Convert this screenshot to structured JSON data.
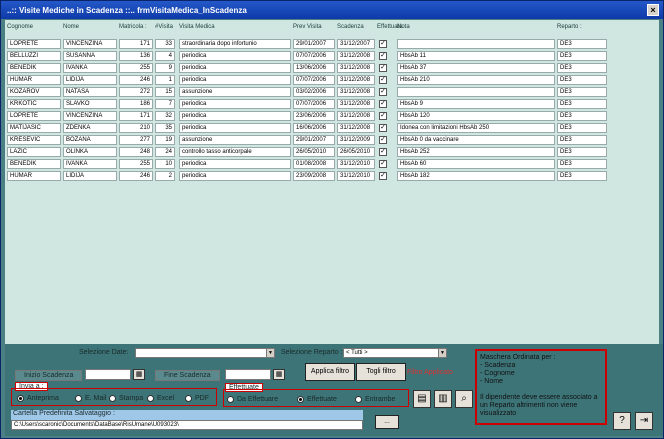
{
  "title": "..:: Visite Mediche in Scadenza ::..   frmVisitaMedica_InScadenza",
  "columns": [
    "Cognome",
    "Nome",
    "Matricola :",
    "#Visita",
    "Visita Medica",
    "Prev Visita",
    "Scadenza",
    "Effettuata",
    "Nota",
    "Reparto :"
  ],
  "rows": [
    [
      "LOPRETE",
      "VINCENZINA",
      "171",
      "33",
      "straordinaria dopo infortunio",
      "29/01/2007",
      "31/12/2007",
      "✓",
      "",
      "DE3"
    ],
    [
      "BELLUZZI",
      "SUSANNA",
      "136",
      "4",
      "periodica",
      "07/07/2006",
      "31/12/2008",
      "✓",
      "HbsAb 11",
      "DE3"
    ],
    [
      "BENEDIK",
      "IVANKA",
      "255",
      "9",
      "periodica",
      "13/06/2006",
      "31/12/2008",
      "✓",
      "HbsAb 37",
      "DE3"
    ],
    [
      "HUMAR",
      "LIDIJA",
      "246",
      "1",
      "periodica",
      "07/07/2006",
      "31/12/2008",
      "✓",
      "HbsAb 210",
      "DE3"
    ],
    [
      "KOZAROV",
      "NATASA",
      "272",
      "15",
      "assunzione",
      "03/02/2006",
      "31/12/2008",
      "✓",
      "",
      "DE3"
    ],
    [
      "KRKOTIC",
      "SLAVKO",
      "186",
      "7",
      "periodica",
      "07/07/2006",
      "31/12/2008",
      "✓",
      "HbsAb 9",
      "DE3"
    ],
    [
      "LOPRETE",
      "VINCENZINA",
      "171",
      "32",
      "periodica",
      "23/06/2006",
      "31/12/2008",
      "✓",
      "HbsAb 120",
      "DE3"
    ],
    [
      "MATIJASIC",
      "ZDENKA",
      "210",
      "35",
      "periodica",
      "16/06/2006",
      "31/12/2008",
      "✓",
      "Idonea con limitazioni HbsAb 250",
      "DE3"
    ],
    [
      "KRESEVIC",
      "BOZANA",
      "277",
      "19",
      "assunzione",
      "29/01/2007",
      "31/12/2009",
      "✓",
      "HbsAb 0 da vaccinare",
      "DE3"
    ],
    [
      "LAZIC",
      "OLINKA",
      "248",
      "24",
      "controllo tasso anticorpale",
      "26/05/2010",
      "26/05/2010",
      "✓",
      "HbsAb 252",
      "DE3"
    ],
    [
      "BENEDIK",
      "IVANKA",
      "255",
      "10",
      "periodica",
      "01/08/2008",
      "31/12/2010",
      "✓",
      "HbsAb 60",
      "DE3"
    ],
    [
      "HUMAR",
      "LIDIJA",
      "246",
      "2",
      "periodica",
      "23/09/2008",
      "31/12/2010",
      "✓",
      "HbsAb 182",
      "DE3"
    ]
  ],
  "filters": {
    "selezione_date_label": "Selezione Date:",
    "selezione_date_value": "",
    "selezione_reparto_label": "Selezione Reparto :",
    "selezione_reparto_value": "<  Tutti  >",
    "inizio_label": "Inizio Scadenza",
    "fine_label": "Fine Scadenza",
    "applica_label": "Applica filtro",
    "togli_label": "Togli filtro",
    "filtro_applicato": "Filtro Applicato"
  },
  "invia": {
    "label": "Invia a :",
    "options": [
      "Anteprima",
      "E. Mail",
      "Stampa",
      "Excel",
      "PDF"
    ],
    "selected": 0
  },
  "effettuate": {
    "label": "Effettuate",
    "options": [
      "Da Effettuare",
      "Effettuate",
      "Entrambe"
    ],
    "selected": 1
  },
  "cartella": {
    "label": "Cartella Predefinita Salvataggio :",
    "value": "C:\\Users\\scaronic\\Documents\\DataBase\\RisUmane\\U093023\\",
    "browse_label": "..."
  },
  "info_text": [
    "Maschera Ordinata per :",
    "- Scadenza",
    "- Cognome",
    "- Nome",
    "",
    "Il dipendente deve essere associato a un Reparto altrimenti non viene visualizzato"
  ]
}
